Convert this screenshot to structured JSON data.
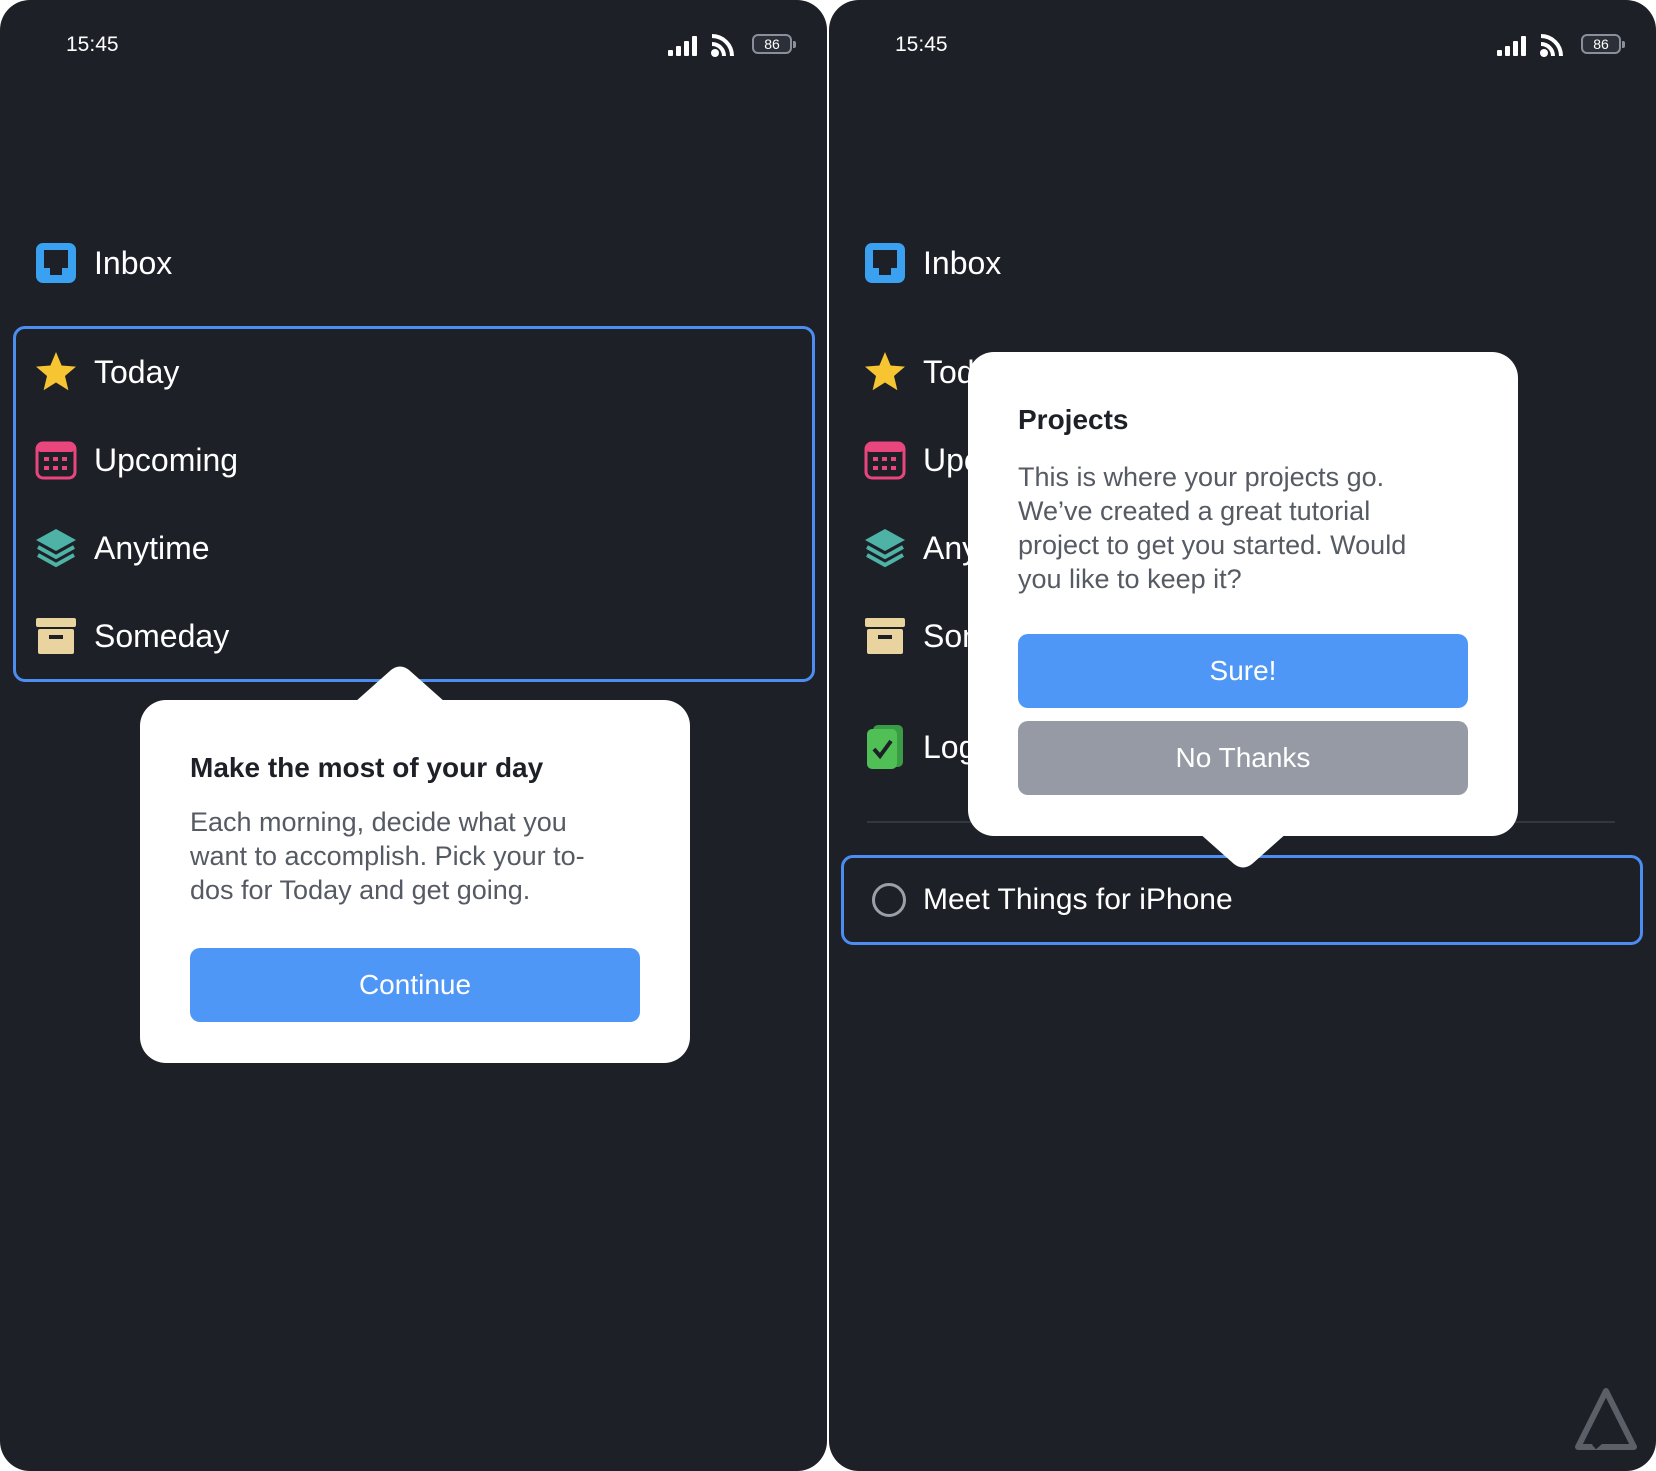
{
  "status": {
    "time": "15:45",
    "battery": "86"
  },
  "left": {
    "inbox": "Inbox",
    "lists": [
      "Today",
      "Upcoming",
      "Anytime",
      "Someday"
    ],
    "popover": {
      "title": "Make the most of your day",
      "body": "Each morning, decide what you want to accomplish. Pick your to-dos for Today and get going.",
      "continue": "Continue"
    }
  },
  "right": {
    "inbox": "Inbox",
    "lists": [
      "Today",
      "Upcoming",
      "Anytime",
      "Someday",
      "Logbook"
    ],
    "popover": {
      "title": "Projects",
      "body": "This is where your projects go. We’ve created a great tutorial project to get you started. Would you like to keep it?",
      "sure": "Sure!",
      "no_thanks": "No Thanks"
    },
    "project": "Meet Things for iPhone"
  },
  "colors": {
    "background": "#1d2027",
    "accent": "#4f97f7",
    "highlight": "#4d8df2",
    "inbox": "#3aa0f0",
    "today": "#f7c531",
    "upcoming": "#e8467c",
    "anytime": "#4fb2a7",
    "someday": "#e9d4a0",
    "logbook": "#4fbf56"
  },
  "icons": [
    "signal-icon",
    "wifi-icon",
    "inbox-icon",
    "star-icon",
    "calendar-icon",
    "layers-icon",
    "archive-icon",
    "logbook-icon",
    "circle-checkbox-icon"
  ]
}
